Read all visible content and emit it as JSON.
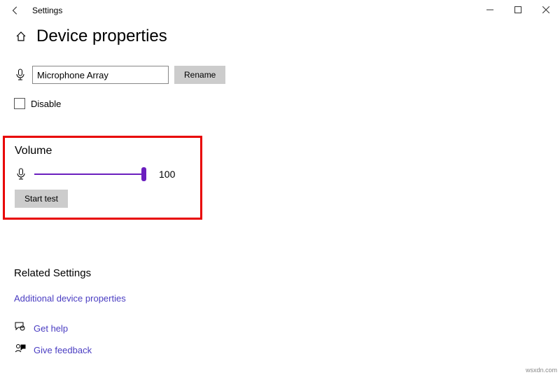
{
  "titlebar": {
    "app_name": "Settings"
  },
  "header": {
    "page_title": "Device properties"
  },
  "device": {
    "name_value": "Microphone Array",
    "rename_label": "Rename",
    "disable_label": "Disable"
  },
  "volume": {
    "heading": "Volume",
    "value": "100",
    "start_test_label": "Start test"
  },
  "related": {
    "heading": "Related Settings",
    "additional_link": "Additional device properties"
  },
  "help": {
    "get_help": "Get help",
    "give_feedback": "Give feedback"
  },
  "watermark": "wsxdn.com"
}
